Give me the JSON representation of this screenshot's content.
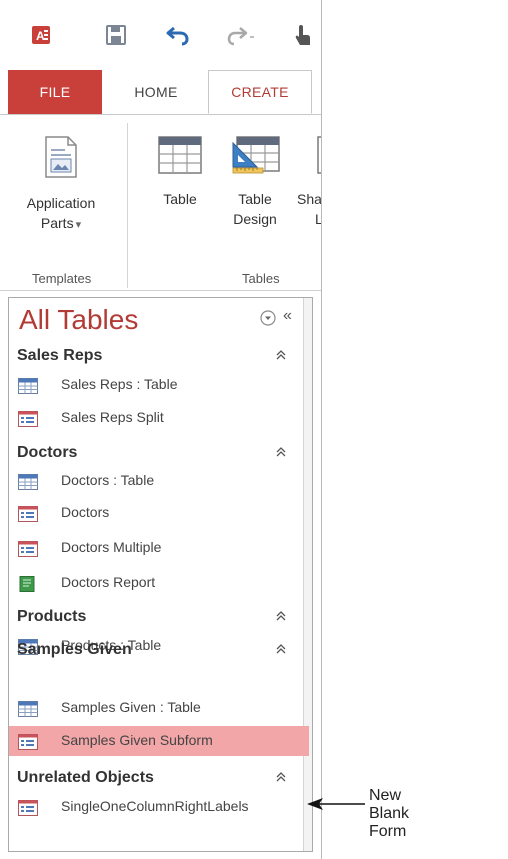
{
  "qat": {
    "icons": [
      "access-logo-icon",
      "save-icon",
      "undo-icon",
      "redo-icon",
      "touch-mode-icon"
    ],
    "colors": {
      "access_red": "#c9403b",
      "save_gray": "#7c8594",
      "undo_blue": "#2b6ab0"
    }
  },
  "tabs": {
    "file": "FILE",
    "home": "HOME",
    "create": "CREATE"
  },
  "ribbon": {
    "templates": {
      "app_parts_line1": "Application",
      "app_parts_line2": "Parts",
      "app_parts_arrow": "▾",
      "group_label": "Templates"
    },
    "tables": {
      "table_label": "Table",
      "table_design_line1": "Table",
      "table_design_line2": "Design",
      "sharepoint_partial_line1": "Sha",
      "sharepoint_partial_line2": "L",
      "group_label": "Tables"
    }
  },
  "nav": {
    "title": "All Tables",
    "collapse_glyph": "«",
    "groups": [
      {
        "title": "Sales Reps",
        "items": [
          {
            "label": "Sales Reps : Table",
            "icon": "table-icon",
            "selected": false
          },
          {
            "label": "Sales Reps Split",
            "icon": "form-icon",
            "selected": false
          }
        ]
      },
      {
        "title": "Doctors",
        "items": [
          {
            "label": "Doctors : Table",
            "icon": "table-icon",
            "selected": false
          },
          {
            "label": "Doctors",
            "icon": "form-icon",
            "selected": false
          },
          {
            "label": "Doctors Multiple",
            "icon": "form-icon",
            "selected": false
          },
          {
            "label": "Doctors Report",
            "icon": "report-icon",
            "selected": false
          }
        ]
      },
      {
        "title": "Products",
        "items": [
          {
            "label": "Products : Table",
            "icon": "table-icon",
            "selected": false
          }
        ]
      },
      {
        "title": "Samples Given",
        "items": [
          {
            "label": "Samples Given : Table",
            "icon": "table-icon",
            "selected": false
          },
          {
            "label": "Samples Given Subform",
            "icon": "form-icon",
            "selected": true
          }
        ]
      },
      {
        "title": "Unrelated Objects",
        "items": [
          {
            "label": "SingleOneColumnRightLabels",
            "icon": "form-icon",
            "selected": false
          }
        ]
      }
    ],
    "selected_color": "#f2a6a8"
  },
  "callout": {
    "text": "New Blank Form"
  }
}
